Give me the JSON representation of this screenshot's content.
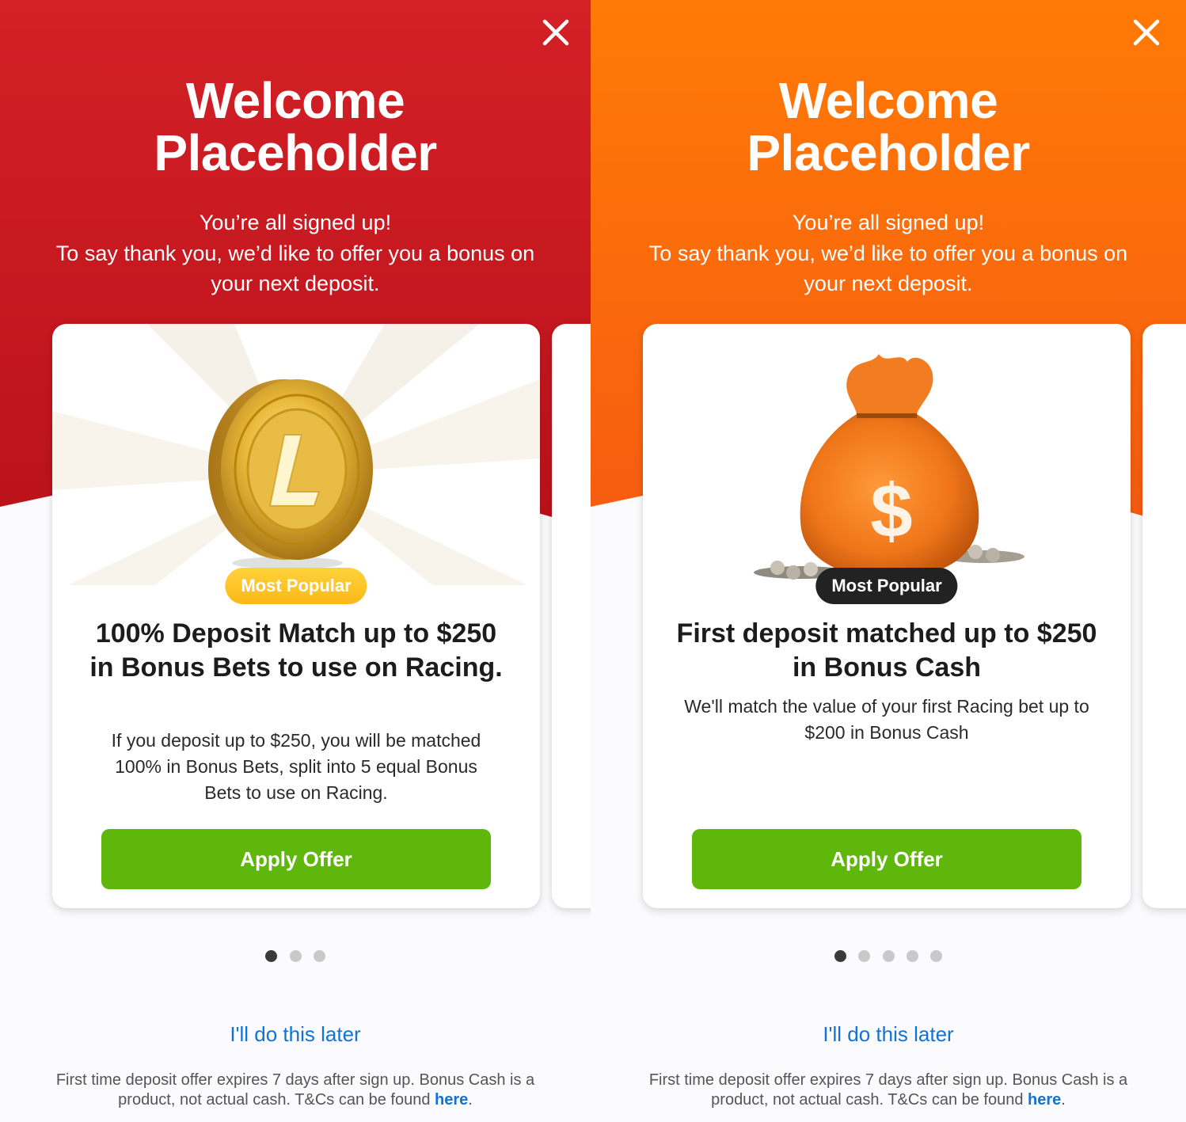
{
  "panels": [
    {
      "id": "left",
      "theme_color": "#d42027",
      "title_line1": "Welcome",
      "title_line2": "Placeholder",
      "intro_line1": "You’re all signed up!",
      "intro_line2": "To say thank you, we’d like to offer you a bonus on",
      "intro_line3": "your next deposit.",
      "card": {
        "image_icon": "gold-coin-icon",
        "badge": "Most Popular",
        "badge_style": "gold",
        "offer_title": "100% Deposit Match up to $250 in Bonus Bets to use on Racing.",
        "offer_description": "If you deposit up to $250, you will be matched 100% in Bonus Bets, split into 5 equal Bonus Bets to use on Racing.",
        "apply_label": "Apply Offer"
      },
      "pager": {
        "total": 3,
        "active": 1
      },
      "later_label": "I'll do this later",
      "footer_text": "First time deposit offer expires 7 days after sign up. Bonus Cash is a product, not actual cash. T&Cs can be found ",
      "footer_link": "here",
      "footer_end": "."
    },
    {
      "id": "right",
      "theme_color": "#ff7a06",
      "title_line1": "Welcome",
      "title_line2": "Placeholder",
      "intro_line1": "You’re all signed up!",
      "intro_line2": "To say thank you, we’d like to offer you a bonus on",
      "intro_line3": "your next deposit.",
      "card": {
        "image_icon": "money-bag-icon",
        "badge": "Most Popular",
        "badge_style": "dark",
        "offer_title": "First deposit matched up to $250 in Bonus Cash",
        "offer_description": "We'll match the value of your first Racing bet up to $200 in Bonus Cash",
        "apply_label": "Apply Offer"
      },
      "pager": {
        "total": 5,
        "active": 1
      },
      "later_label": "I'll do this later",
      "footer_text": "First time deposit offer expires 7 days after sign up. Bonus Cash is a product, not actual cash. T&Cs can be found ",
      "footer_link": "here",
      "footer_end": "."
    }
  ]
}
